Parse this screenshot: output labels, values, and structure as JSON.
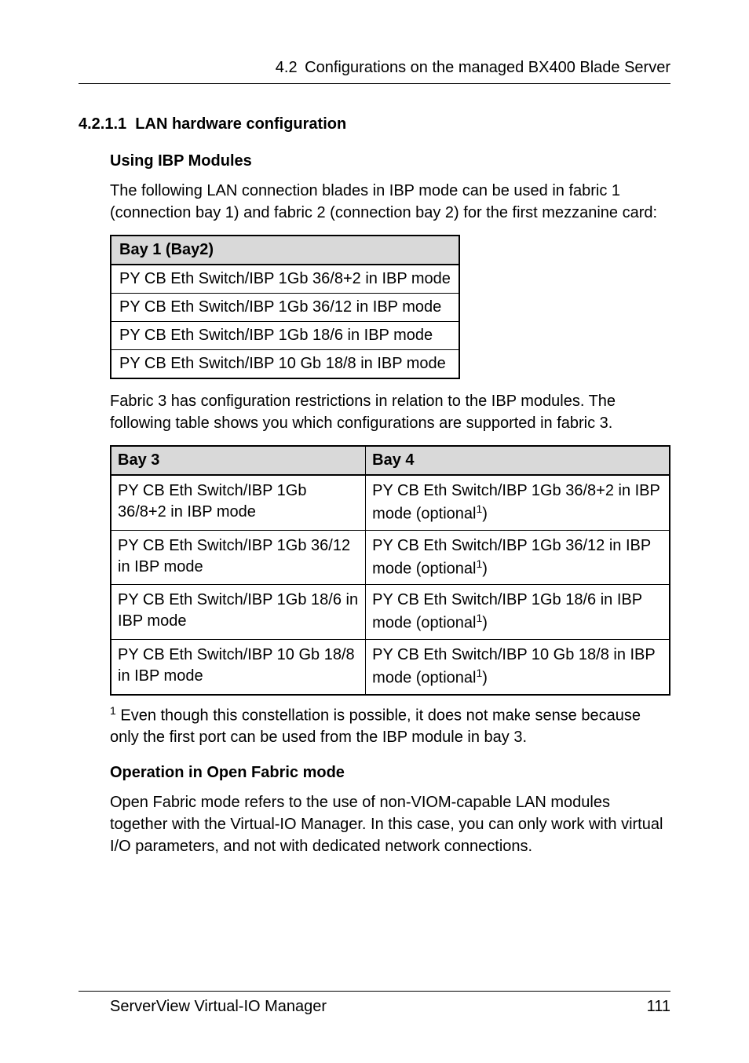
{
  "header": {
    "number": "4.2",
    "title": "Configurations on the managed BX400 Blade Server"
  },
  "subsection": {
    "number": "4.2.1.1",
    "title": "LAN hardware configuration"
  },
  "ibp": {
    "heading": "Using IBP Modules",
    "intro": "The following LAN connection blades in IBP mode can be used in fabric 1 (connection bay 1) and fabric 2 (connection bay 2) for the first mezzanine card:"
  },
  "table1": {
    "header": "Bay 1 (Bay2)",
    "rows": [
      "PY CB Eth Switch/IBP 1Gb 36/8+2 in IBP mode",
      "PY CB Eth Switch/IBP 1Gb 36/12 in IBP mode",
      "PY CB Eth Switch/IBP 1Gb 18/6 in IBP mode",
      "PY CB Eth Switch/IBP 10 Gb 18/8 in IBP mode"
    ]
  },
  "fabric3_text": "Fabric 3 has configuration restrictions in relation to the IBP modules. The following table shows you which configurations are supported in fabric 3.",
  "table2": {
    "headers": [
      "Bay 3",
      "Bay 4"
    ],
    "rows": [
      {
        "bay3": "PY CB Eth Switch/IBP 1Gb 36/8+2 in IBP mode",
        "bay4_pre": "PY CB Eth Switch/IBP 1Gb 36/8+2 in IBP mode (optional",
        "bay4_post": ")"
      },
      {
        "bay3": "PY CB Eth Switch/IBP 1Gb 36/12 in IBP mode",
        "bay4_pre": "PY CB Eth Switch/IBP 1Gb 36/12 in IBP mode (optional",
        "bay4_post": ")"
      },
      {
        "bay3": "PY CB Eth Switch/IBP 1Gb 18/6 in IBP mode",
        "bay4_pre": "PY CB Eth Switch/IBP 1Gb 18/6 in IBP mode (optional",
        "bay4_post": ")"
      },
      {
        "bay3": "PY CB Eth Switch/IBP 10 Gb 18/8 in IBP mode",
        "bay4_pre": "PY CB Eth Switch/IBP 10 Gb 18/8 in IBP mode (optional",
        "bay4_post": ")"
      }
    ]
  },
  "footnote": {
    "marker": "1",
    "text": " Even though this constellation is possible, it does not make sense because only the first port can be used from the IBP module in bay 3."
  },
  "openfabric": {
    "heading": "Operation in Open Fabric mode",
    "text": "Open Fabric mode refers to the use of non-VIOM-capable LAN modules together with the Virtual-IO Manager. In this case, you can only work with virtual I/O parameters, and not with dedicated network connections."
  },
  "footer": {
    "left": "ServerView Virtual-IO Manager",
    "right": "111"
  },
  "superscript": "1"
}
